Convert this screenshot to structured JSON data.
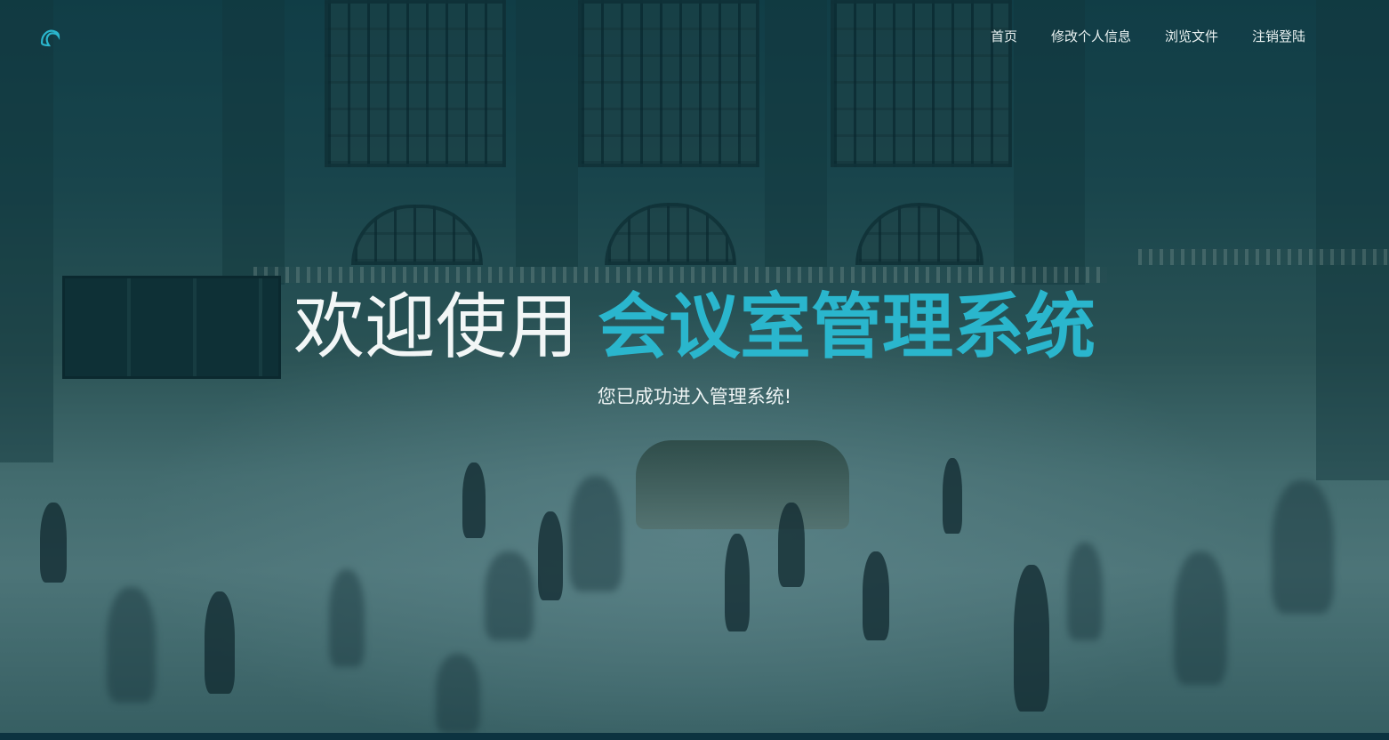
{
  "nav": {
    "items": [
      "首页",
      "修改个人信息",
      "浏览文件",
      "注销登陆"
    ]
  },
  "hero": {
    "title_prefix": "欢迎使用",
    "title_highlight": "会议室管理系统",
    "subtitle": "您已成功进入管理系统!"
  },
  "icons": {
    "logo": "crescent-logo-icon"
  },
  "colors": {
    "accent": "#2ab6cd",
    "overlay": "#123e48",
    "text": "#f2f6f6"
  }
}
